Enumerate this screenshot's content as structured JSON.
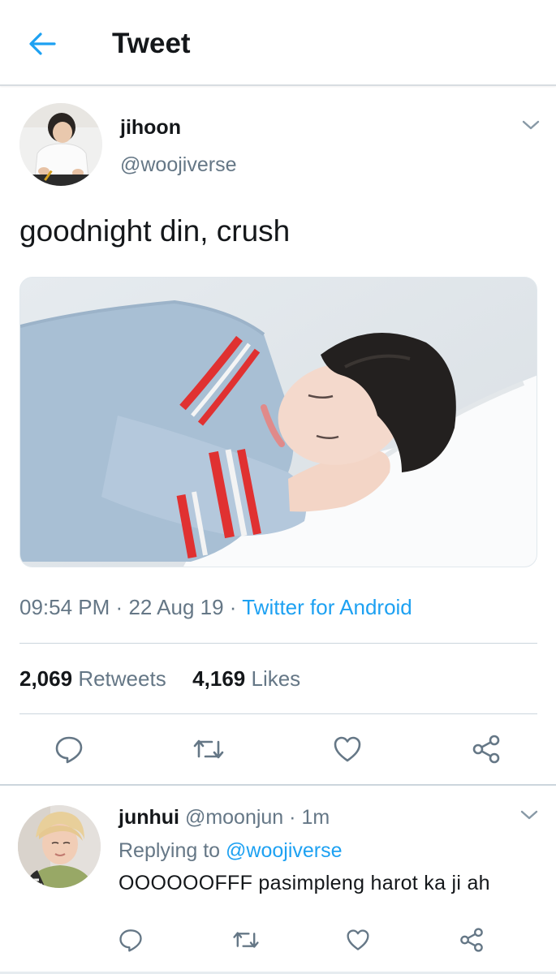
{
  "header": {
    "title": "Tweet",
    "back_icon": "arrow-left-icon",
    "accent": "#1da1f2"
  },
  "tweet": {
    "author_name": "jihoon",
    "author_handle": "@woojiverse",
    "text": "goodnight din, crush",
    "time": "09:54 PM",
    "date": "22 Aug 19",
    "separator": "·",
    "source": "Twitter for Android",
    "retweets_count": "2,069",
    "retweets_label": "Retweets",
    "likes_count": "4,169",
    "likes_label": "Likes",
    "actions": [
      "reply-icon",
      "retweet-icon",
      "like-icon",
      "share-icon"
    ]
  },
  "reply": {
    "author_name": "junhui",
    "author_handle": "@moonjun",
    "separator": "·",
    "age": "1m",
    "replying_prefix": "Replying to",
    "replying_to": "@woojiverse",
    "text": "OOOOOOFFF pasimpleng harot ka ji ah",
    "actions": [
      "reply-icon",
      "retweet-icon",
      "like-icon",
      "share-icon"
    ]
  },
  "colors": {
    "text_primary": "#14171a",
    "text_secondary": "#657786",
    "link": "#1da1f2",
    "divider": "#ccd6dd"
  }
}
